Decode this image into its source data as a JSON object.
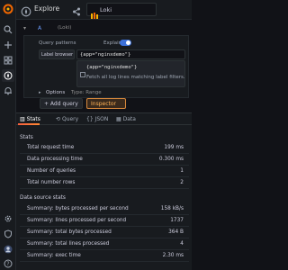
{
  "topbar": {
    "title": "Explore",
    "datasource": "Loki"
  },
  "query": {
    "name": "A",
    "datasource_hint": "(Loki)",
    "query_patterns_label": "Query patterns",
    "explain_label": "Explain",
    "label_browser_label": "Label browser",
    "expression": "{app=\"nginxdemo\"}",
    "suggestion_item": "{app=\"nginxdemo\"}",
    "suggestion_desc": "Fetch all log lines matching label filters.",
    "options_label": "Options",
    "options_value": "Type: Range",
    "add_query_label": "+ Add query",
    "inspector_label": "Inspector"
  },
  "inspector": {
    "tabs": [
      {
        "label": "Stats",
        "icon": "chart-icon",
        "active": true
      },
      {
        "label": "Query",
        "icon": "query-icon",
        "active": false
      },
      {
        "label": "JSON",
        "icon": "braces-icon",
        "active": false
      },
      {
        "label": "Data",
        "icon": "table-icon",
        "active": false
      }
    ],
    "stats_title": "Stats",
    "stats": [
      {
        "key": "Total request time",
        "value": "199 ms"
      },
      {
        "key": "Data processing time",
        "value": "0.300 ms"
      },
      {
        "key": "Number of queries",
        "value": "1"
      },
      {
        "key": "Total number rows",
        "value": "2"
      }
    ],
    "ds_stats_title": "Data source stats",
    "ds_stats": [
      {
        "key": "Summary: bytes processed per second",
        "value": "158 kB/s"
      },
      {
        "key": "Summary: lines processed per second",
        "value": "1737"
      },
      {
        "key": "Summary: total bytes processed",
        "value": "364 B"
      },
      {
        "key": "Summary: total lines processed",
        "value": "4"
      },
      {
        "key": "Summary: exec time",
        "value": "2.30 ms"
      }
    ]
  },
  "colors": {
    "accent_blue": "#3d71d9",
    "inspector_orange": "#ffb357",
    "tab_gradient_start": "#f55f3e",
    "tab_gradient_end": "#ff8833"
  }
}
